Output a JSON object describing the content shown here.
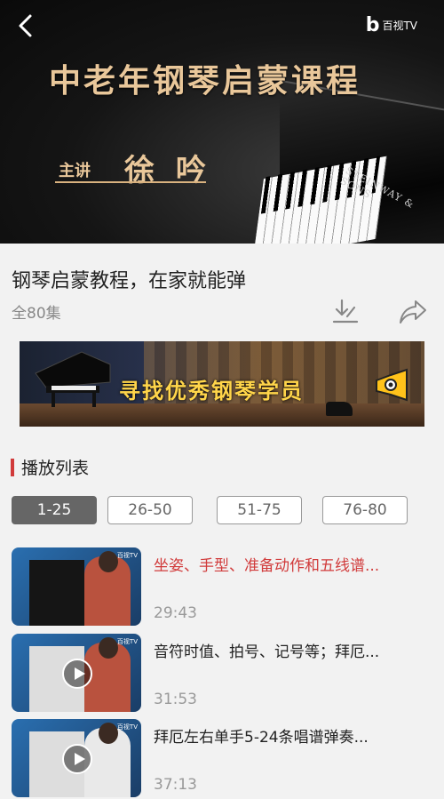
{
  "hero": {
    "title": "中老年钢琴启蒙课程",
    "lecturer_label": "主讲",
    "lecturer_name": "徐 吟",
    "piano_brand": "STEINWAY & SONS",
    "logo_text": "百视TV",
    "logo_mark": "b"
  },
  "info": {
    "title": "钢琴启蒙教程，在家就能弹",
    "episodes": "全80集"
  },
  "banner": {
    "text": "寻找优秀钢琴学员"
  },
  "playlist": {
    "heading": "播放列表",
    "tabs": [
      {
        "label": "1-25",
        "active": true
      },
      {
        "label": "26-50",
        "active": false
      },
      {
        "label": "51-75",
        "active": false
      },
      {
        "label": "76-80",
        "active": false
      }
    ],
    "items": [
      {
        "title": "坐姿、手型、准备动作和五线谱...",
        "duration": "29:43",
        "current": true
      },
      {
        "title": "音符时值、拍号、记号等；拜厄...",
        "duration": "31:53",
        "current": false
      },
      {
        "title": "拜厄左右单手5-24条唱谱弹奏...",
        "duration": "37:13",
        "current": false
      }
    ]
  },
  "colors": {
    "accent": "#d13b3b",
    "gold": "#e9c79a",
    "banner_text": "#ffd54a"
  }
}
